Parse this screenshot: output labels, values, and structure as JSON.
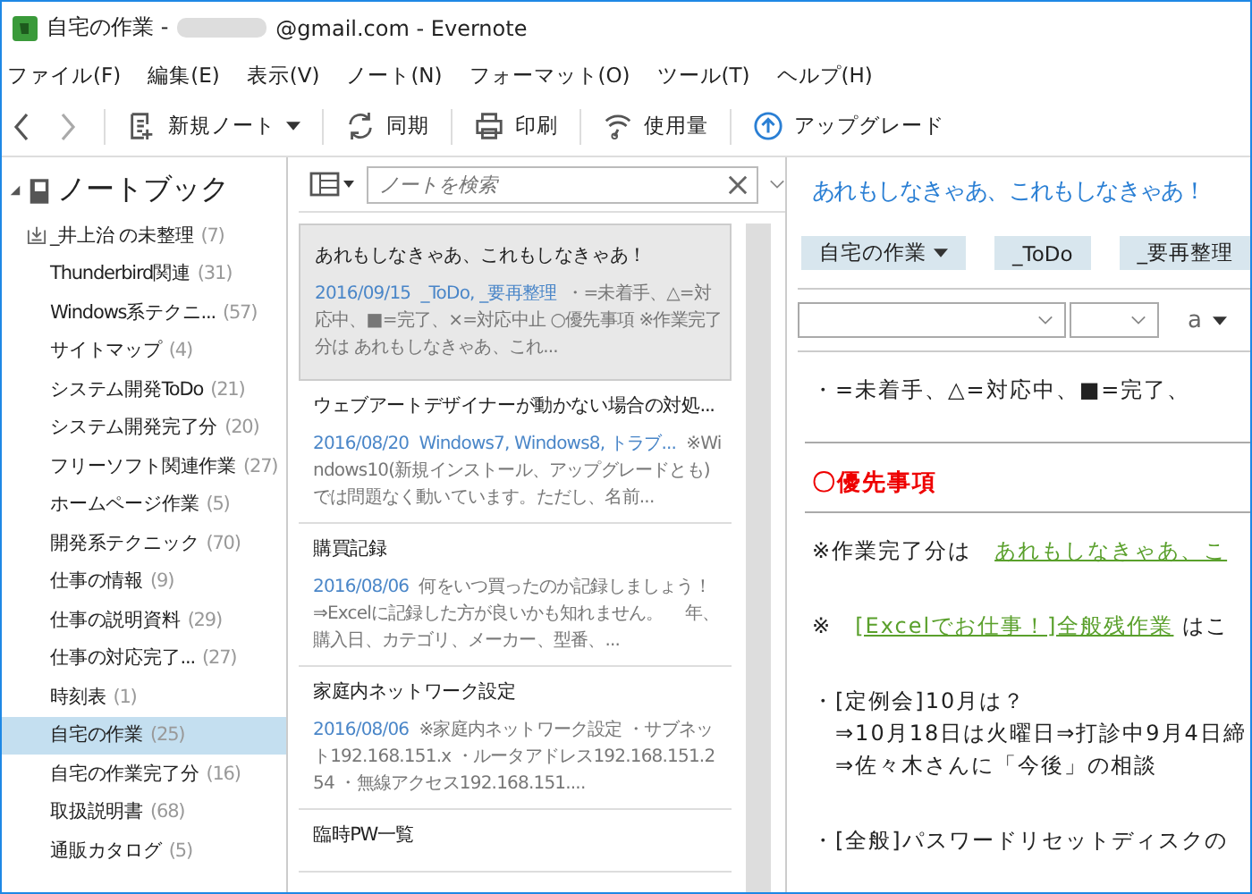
{
  "window": {
    "title_before": "自宅の作業 -",
    "title_after": "@gmail.com - Evernote"
  },
  "menu": [
    "ファイル(F)",
    "編集(E)",
    "表示(V)",
    "ノート(N)",
    "フォーマット(O)",
    "ツール(T)",
    "ヘルプ(H)"
  ],
  "toolbar": [
    {
      "kind": "new",
      "label": "新規ノート"
    },
    {
      "kind": "sync",
      "label": "同期"
    },
    {
      "kind": "print",
      "label": "印刷"
    },
    {
      "kind": "usage",
      "label": "使用量"
    },
    {
      "kind": "upgrade",
      "label": "アップグレード"
    }
  ],
  "sidebar": {
    "title": "ノートブック",
    "expanded": true,
    "items": [
      {
        "kind": "default",
        "name": "_井上治 の未整理",
        "count": "(7)",
        "selected": false
      },
      {
        "kind": "notebook",
        "name": "Thunderbird関連",
        "count": "(31)",
        "selected": false
      },
      {
        "kind": "notebook",
        "name": "Windows系テクニ...",
        "count": "(57)",
        "selected": false
      },
      {
        "kind": "notebook",
        "name": "サイトマップ",
        "count": "(4)",
        "selected": false
      },
      {
        "kind": "notebook",
        "name": "システム開発ToDo",
        "count": "(21)",
        "selected": false
      },
      {
        "kind": "notebook",
        "name": "システム開発完了分",
        "count": "(20)",
        "selected": false
      },
      {
        "kind": "notebook",
        "name": "フリーソフト関連作業",
        "count": "(27)",
        "selected": false
      },
      {
        "kind": "notebook",
        "name": "ホームページ作業",
        "count": "(5)",
        "selected": false
      },
      {
        "kind": "notebook",
        "name": "開発系テクニック",
        "count": "(70)",
        "selected": false
      },
      {
        "kind": "notebook",
        "name": "仕事の情報",
        "count": "(9)",
        "selected": false
      },
      {
        "kind": "notebook",
        "name": "仕事の説明資料",
        "count": "(29)",
        "selected": false
      },
      {
        "kind": "notebook",
        "name": "仕事の対応完了...",
        "count": "(27)",
        "selected": false
      },
      {
        "kind": "notebook",
        "name": "時刻表",
        "count": "(1)",
        "selected": false
      },
      {
        "kind": "notebook",
        "name": "自宅の作業",
        "count": "(25)",
        "selected": true
      },
      {
        "kind": "notebook",
        "name": "自宅の作業完了分",
        "count": "(16)",
        "selected": false
      },
      {
        "kind": "notebook",
        "name": "取扱説明書",
        "count": "(68)",
        "selected": false
      },
      {
        "kind": "notebook",
        "name": "通販カタログ",
        "count": "(5)",
        "selected": false
      }
    ]
  },
  "search": {
    "placeholder": "ノートを検索"
  },
  "notes": [
    {
      "title": "あれもしなきゃあ、これもしなきゃあ！",
      "date": "2016/09/15",
      "tags": "_ToDo, _要再整理",
      "snippet": "・=未着手、△=対応中、■=完了、×=対応中止 ○優先事項 ※作業完了分は あれもしなきゃあ、これ...",
      "selected": true
    },
    {
      "title": "ウェブアートデザイナーが動かない場合の対処...",
      "date": "2016/08/20",
      "tags": "Windows7, Windows8, トラブ...",
      "snippet": "※Windows10(新規インストール、アップグレードとも)では問題なく動いています。ただし、名前...",
      "selected": false
    },
    {
      "title": "購買記録",
      "date": "2016/08/06",
      "snippet": "何をいつ買ったのか記録しましょう！ ⇒Excelに記録した方が良いかも知れません。　 年、購入日、カテゴリ、メーカー、型番、...",
      "selected": false
    },
    {
      "title": "家庭内ネットワーク設定",
      "date": "2016/08/06",
      "snippet": "※家庭内ネットワーク設定 ・サブネット192.168.151.x ・ルータアドレス192.168.151.254 ・無線アクセス192.168.151....",
      "selected": false
    },
    {
      "title": "臨時PW一覧",
      "selected": false
    }
  ],
  "editor": {
    "title": "あれもしなきゃあ、これもしなきゃあ！",
    "notebook": "自宅の作業",
    "tags": [
      "_ToDo",
      "_要再整理"
    ],
    "font_size_label": "a",
    "body": [
      {
        "kind": "lead",
        "lines": [
          [
            {
              "text": "・=未着手、△=対応中、■=完了、",
              "link": false
            }
          ]
        ]
      },
      {
        "kind": "heading",
        "lines": [
          [
            {
              "text": "〇優先事項",
              "link": false
            }
          ]
        ]
      },
      {
        "kind": "para",
        "lines": [
          [
            {
              "text": "※作業完了分は　",
              "link": false
            },
            {
              "text": "あれもしなきゃあ、こ",
              "link": true
            }
          ]
        ]
      },
      {
        "kind": "para",
        "lines": [
          [
            {
              "text": "※　",
              "link": false
            },
            {
              "text": "[Excelでお仕事！]全般残作業",
              "link": true
            },
            {
              "text": " はこ",
              "link": false
            }
          ]
        ]
      },
      {
        "kind": "para",
        "lines": [
          [
            {
              "text": "・[定例会]10月は？",
              "link": false
            }
          ],
          [
            {
              "text": "　⇒10月18日は火曜日⇒打診中9月4日締",
              "link": false
            }
          ],
          [
            {
              "text": "　⇒佐々木さんに「今後」の相談",
              "link": false
            }
          ]
        ]
      },
      {
        "kind": "para",
        "lines": [
          [
            {
              "text": "・[全般]パスワードリセットディスクの",
              "link": false
            }
          ]
        ]
      }
    ]
  }
}
